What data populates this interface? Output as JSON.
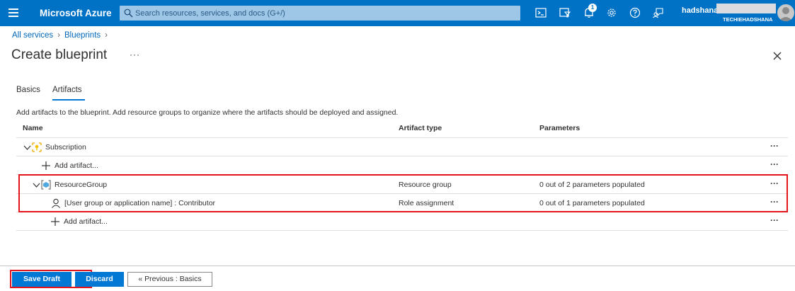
{
  "topbar": {
    "brand": "Microsoft Azure",
    "search_placeholder": "Search resources, services, and docs (G+/)",
    "notification_count": "1",
    "user_name": "hadshana",
    "tenant": "TECHIEHADSHANA",
    "colors": {
      "bar": "#0072c6",
      "search": "#9ec6e7"
    }
  },
  "breadcrumb": {
    "items": [
      "All services",
      "Blueprints"
    ]
  },
  "page": {
    "title": "Create blueprint",
    "more": "···"
  },
  "tabs": [
    {
      "label": "Basics"
    },
    {
      "label": "Artifacts",
      "active": true
    }
  ],
  "description": "Add artifacts to the blueprint. Add resource groups to organize where the artifacts should be deployed and assigned.",
  "table": {
    "columns": [
      "Name",
      "Artifact type",
      "Parameters"
    ],
    "rows": [
      {
        "name": "Subscription",
        "type": "",
        "params": "",
        "more": "···"
      },
      {
        "name": "Add artifact...",
        "type": "",
        "params": "",
        "more": "···"
      },
      {
        "name": "ResourceGroup",
        "type": "Resource group",
        "params": "0 out of 2 parameters populated",
        "more": "···"
      },
      {
        "name": "[User group or application name] : Contributor",
        "type": "Role assignment",
        "params": "0 out of 1 parameters populated",
        "more": "···"
      },
      {
        "name": "Add artifact...",
        "type": "",
        "params": "",
        "more": "···"
      }
    ]
  },
  "footer": {
    "save_label": "Save Draft",
    "discard_label": "Discard",
    "prev_label": "« Previous : Basics"
  },
  "highlight_color": "#e3141c"
}
